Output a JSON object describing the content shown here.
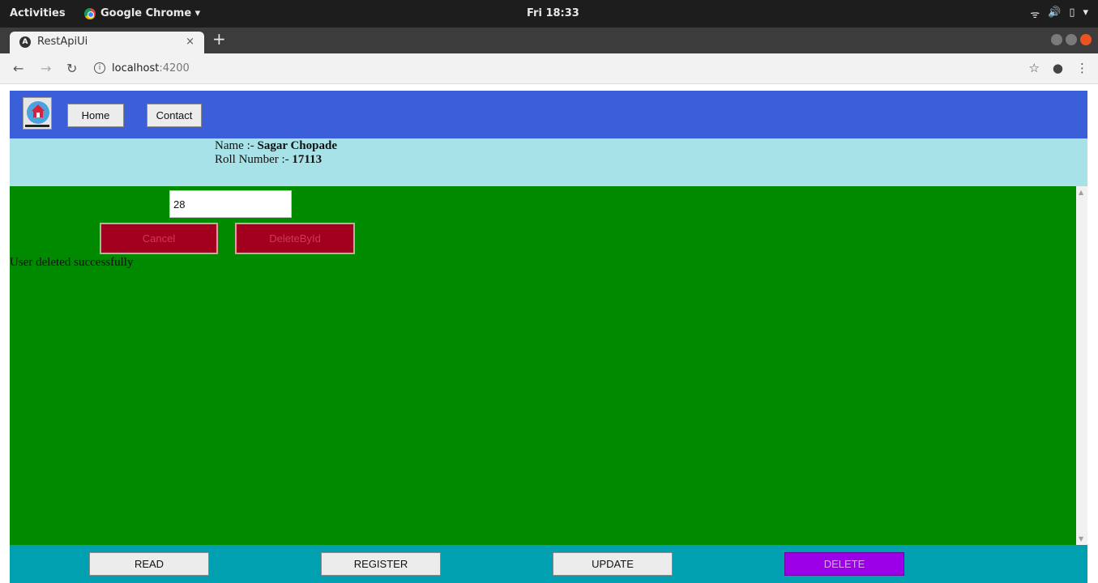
{
  "os": {
    "activities": "Activities",
    "app_name": "Google Chrome ▾",
    "clock": "Fri 18:33",
    "tray_icons": [
      "wifi-icon",
      "volume-icon",
      "battery-icon",
      "menu-arrow-icon"
    ]
  },
  "browser": {
    "tab_title": "RestApiUi",
    "tab_close": "×",
    "new_tab": "+",
    "url_host": "localhost",
    "url_port": ":4200"
  },
  "header": {
    "home_label": "Home",
    "contact_label": "Contact"
  },
  "info": {
    "name_prefix": "Name :- ",
    "name_value": "Sagar Chopade",
    "roll_prefix": "Roll Number :- ",
    "roll_value": "17113"
  },
  "form": {
    "id_value": "28",
    "cancel_label": "Cancel",
    "delete_label": "DeleteById",
    "message": "User deleted successfully"
  },
  "footer": {
    "read_label": "READ",
    "register_label": "REGISTER",
    "update_label": "UPDATE",
    "delete_label": "DELETE",
    "active": "DELETE"
  },
  "colors": {
    "header_bg": "#3b5fd9",
    "info_bg": "#a7e2e8",
    "content_bg": "#008a00",
    "footer_bg": "#00a0b0",
    "danger_btn": "#a3001f",
    "active_btn": "#9b00e8"
  }
}
